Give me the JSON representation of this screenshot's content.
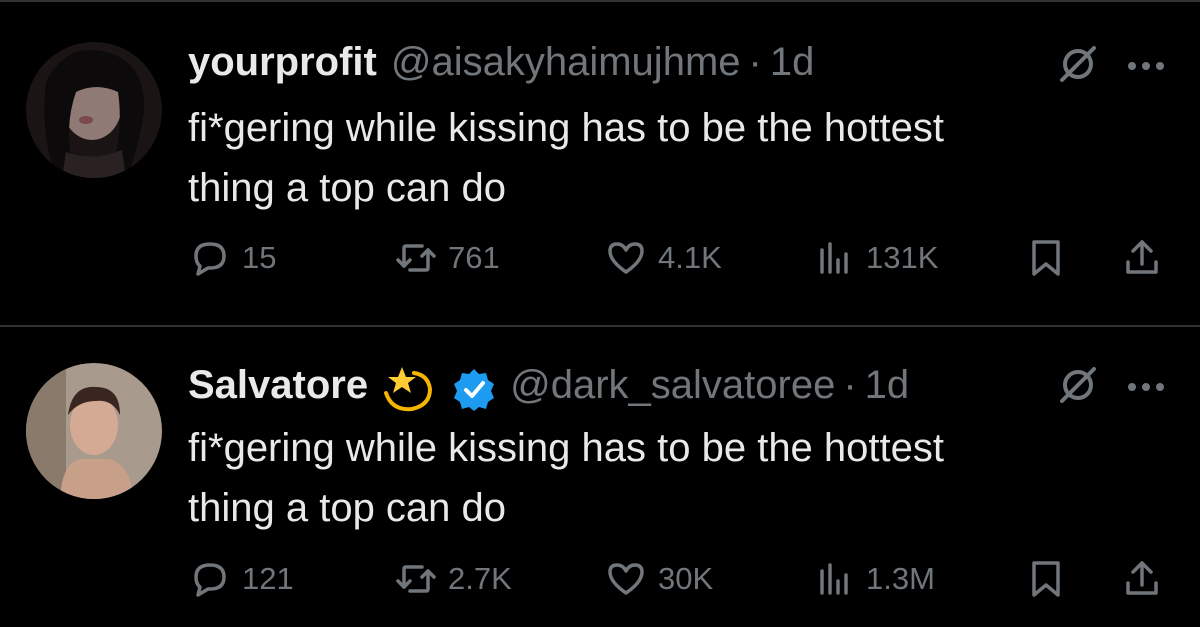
{
  "tweets": [
    {
      "display_name": "yourprofit",
      "handle": "@aisakyhaimujhme",
      "separator": "·",
      "time": "1d",
      "text_line1": "fi*gering while kissing has to be the hottest",
      "text_line2": "thing a top can do",
      "replies": "15",
      "retweets": "761",
      "likes": "4.1K",
      "views": "131K",
      "verified": false
    },
    {
      "display_name": "Salvatore",
      "handle": "@dark_salvatoree",
      "separator": "·",
      "time": "1d",
      "text_line1": "fi*gering while kissing has to be the hottest",
      "text_line2": "thing a top can do",
      "replies": "121",
      "retweets": "2.7K",
      "likes": "30K",
      "views": "1.3M",
      "verified": true
    }
  ],
  "icons": {
    "reply": "reply-icon",
    "retweet": "retweet-icon",
    "like": "heart-icon",
    "views": "views-icon",
    "bookmark": "bookmark-icon",
    "share": "share-icon",
    "grok": "grok-icon",
    "more": "more-icon",
    "verified": "verified-badge-icon",
    "emoji": "dizzy-star-emoji"
  },
  "colors": {
    "background": "#000000",
    "primary_text": "#e7e9ea",
    "secondary_text": "#71767b",
    "divider": "#2f3336",
    "verified_blue": "#1d9bf0"
  }
}
